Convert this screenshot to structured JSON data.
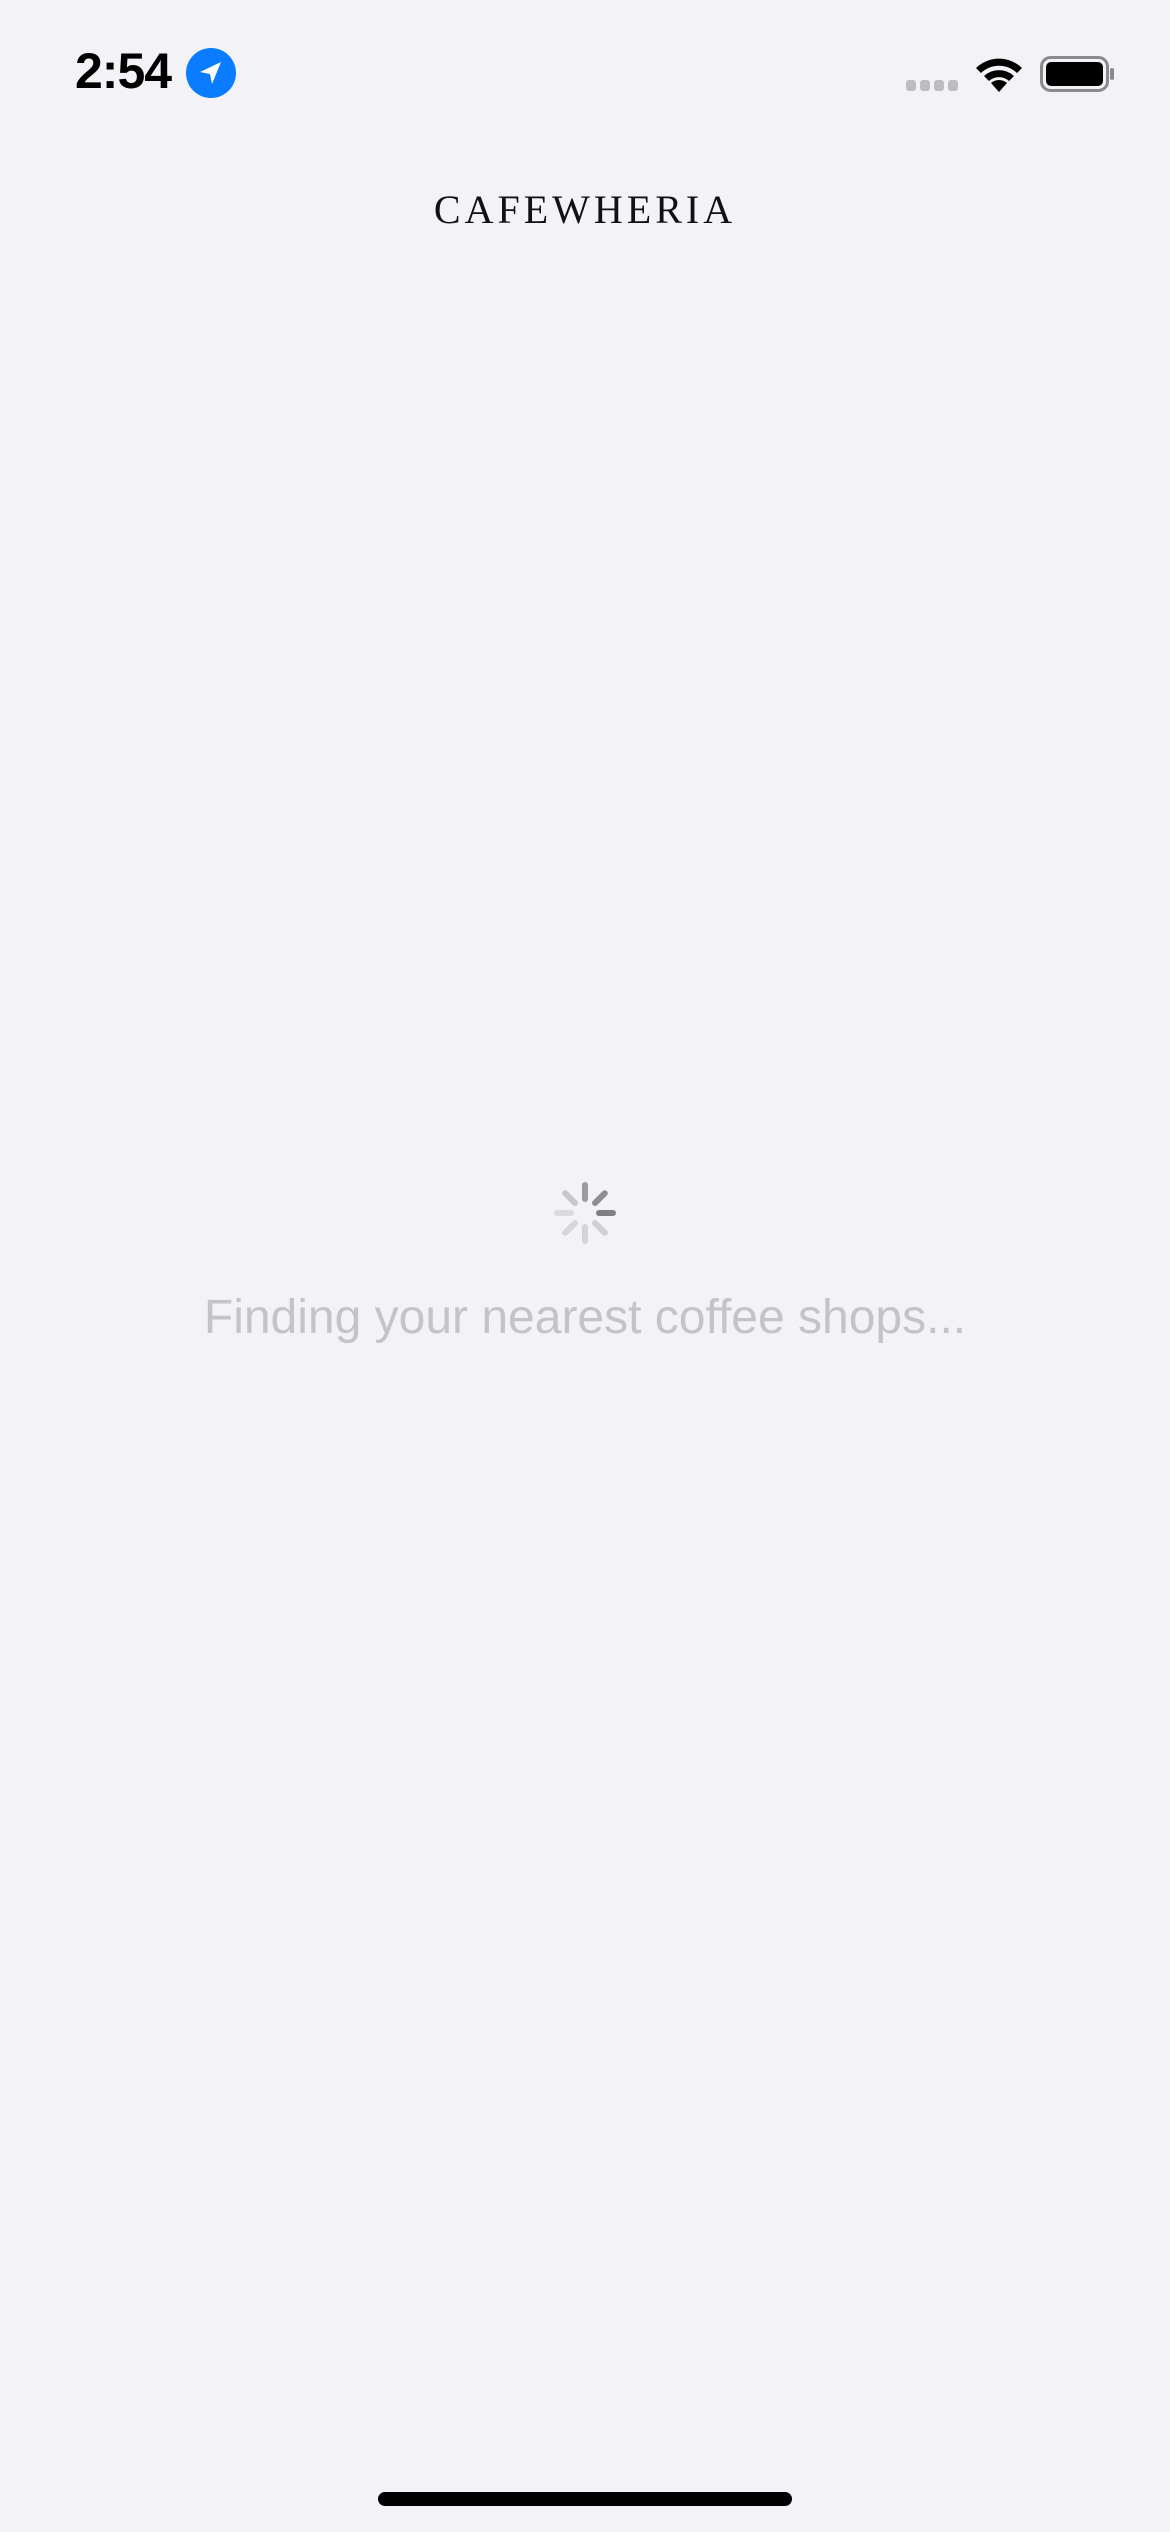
{
  "status_bar": {
    "time": "2:54",
    "location_icon": "location-arrow-icon",
    "signal_icon": "cellular-signal-icon",
    "wifi_icon": "wifi-icon",
    "battery_icon": "battery-icon",
    "battery_level": 1.0,
    "accent_color": "#0a7cff"
  },
  "header": {
    "brand": "CAFEWHERIA"
  },
  "loading": {
    "spinner_icon": "activity-spinner-icon",
    "message": "Finding your nearest coffee shops..."
  },
  "colors": {
    "background": "#f2f2f7",
    "message_text": "#c3c3c9",
    "brand_text": "#111111"
  }
}
